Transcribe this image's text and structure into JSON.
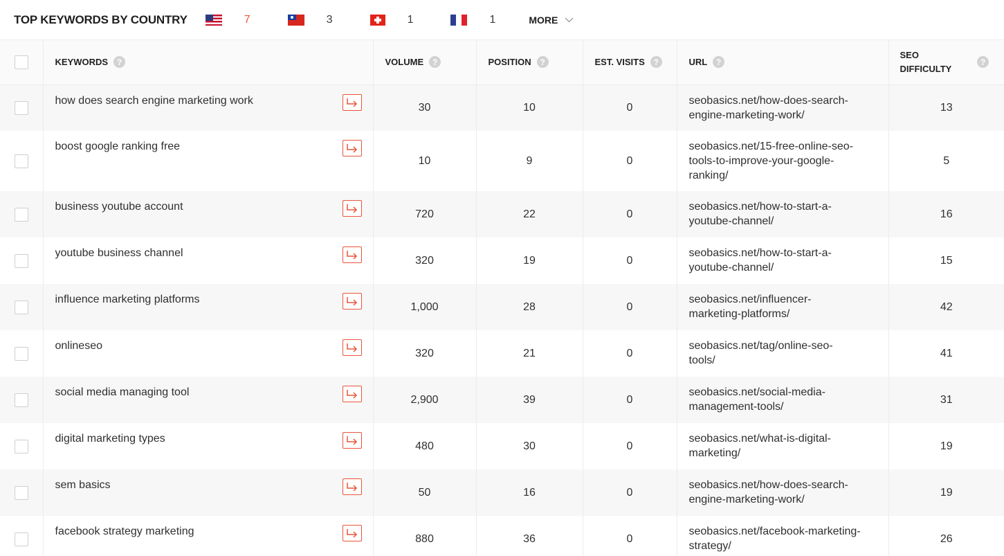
{
  "header": {
    "title": "TOP KEYWORDS BY COUNTRY",
    "countries": [
      {
        "flag": "us-flag",
        "count": "7"
      },
      {
        "flag": "tw-flag",
        "count": "3"
      },
      {
        "flag": "ch-flag",
        "count": "1"
      },
      {
        "flag": "fr-flag",
        "count": "1"
      }
    ],
    "more_label": "MORE"
  },
  "table": {
    "columns": {
      "keywords": "KEYWORDS",
      "volume": "VOLUME",
      "position": "POSITION",
      "est_visits": "EST. VISITS",
      "url": "URL",
      "seo_difficulty_1": "SEO",
      "seo_difficulty_2": "DIFFICULTY"
    },
    "help_glyph": "?",
    "rows": [
      {
        "keyword": "how does search engine marketing work",
        "volume": "30",
        "position": "10",
        "visits": "0",
        "url_1": "seobasics.net/how-does-search-",
        "url_2": "engine-marketing-work/",
        "url_3": "",
        "difficulty": "13"
      },
      {
        "keyword": "boost google ranking free",
        "volume": "10",
        "position": "9",
        "visits": "0",
        "url_1": "seobasics.net/15-free-online-seo-",
        "url_2": "tools-to-improve-your-google-",
        "url_3": "ranking/",
        "difficulty": "5"
      },
      {
        "keyword": "business youtube account",
        "volume": "720",
        "position": "22",
        "visits": "0",
        "url_1": "seobasics.net/how-to-start-a-",
        "url_2": "youtube-channel/",
        "url_3": "",
        "difficulty": "16"
      },
      {
        "keyword": "youtube business channel",
        "volume": "320",
        "position": "19",
        "visits": "0",
        "url_1": "seobasics.net/how-to-start-a-",
        "url_2": "youtube-channel/",
        "url_3": "",
        "difficulty": "15"
      },
      {
        "keyword": "influence marketing platforms",
        "volume": "1,000",
        "position": "28",
        "visits": "0",
        "url_1": "seobasics.net/influencer-",
        "url_2": "marketing-platforms/",
        "url_3": "",
        "difficulty": "42"
      },
      {
        "keyword": "onlineseo",
        "volume": "320",
        "position": "21",
        "visits": "0",
        "url_1": "seobasics.net/tag/online-seo-",
        "url_2": "tools/",
        "url_3": "",
        "difficulty": "41"
      },
      {
        "keyword": "social media managing tool",
        "volume": "2,900",
        "position": "39",
        "visits": "0",
        "url_1": "seobasics.net/social-media-",
        "url_2": "management-tools/",
        "url_3": "",
        "difficulty": "31"
      },
      {
        "keyword": "digital marketing types",
        "volume": "480",
        "position": "30",
        "visits": "0",
        "url_1": "seobasics.net/what-is-digital-",
        "url_2": "marketing/",
        "url_3": "",
        "difficulty": "19"
      },
      {
        "keyword": "sem basics",
        "volume": "50",
        "position": "16",
        "visits": "0",
        "url_1": "seobasics.net/how-does-search-",
        "url_2": "engine-marketing-work/",
        "url_3": "",
        "difficulty": "19"
      },
      {
        "keyword": "facebook strategy marketing",
        "volume": "880",
        "position": "36",
        "visits": "0",
        "url_1": "seobasics.net/facebook-marketing-",
        "url_2": "strategy/",
        "url_3": "",
        "difficulty": "26"
      }
    ]
  },
  "colors": {
    "accent": "#e8553a",
    "row_alt": "#f7f7f7",
    "border": "#ececec"
  }
}
